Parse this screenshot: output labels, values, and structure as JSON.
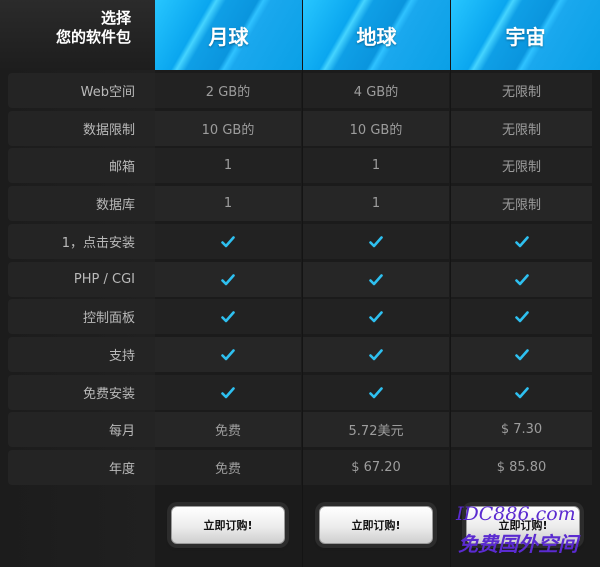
{
  "header": {
    "corner_title": "选择\n您的软件包",
    "plans": [
      "月球",
      "地球",
      "宇宙"
    ]
  },
  "rows": [
    {
      "label": "Web空间",
      "values": [
        "2 GB的",
        "4 GB的",
        "无限制"
      ]
    },
    {
      "label": "数据限制",
      "values": [
        "10 GB的",
        "10 GB的",
        "无限制"
      ]
    },
    {
      "label": "邮箱",
      "values": [
        "1",
        "1",
        "无限制"
      ]
    },
    {
      "label": "数据库",
      "values": [
        "1",
        "1",
        "无限制"
      ]
    },
    {
      "label": "1，点击安装",
      "values": [
        "check",
        "check",
        "check"
      ]
    },
    {
      "label": "PHP / CGI",
      "values": [
        "check",
        "check",
        "check"
      ]
    },
    {
      "label": "控制面板",
      "values": [
        "check",
        "check",
        "check"
      ]
    },
    {
      "label": "支持",
      "values": [
        "check",
        "check",
        "check"
      ]
    },
    {
      "label": "免费安装",
      "values": [
        "check",
        "check",
        "check"
      ]
    },
    {
      "label": "每月",
      "values": [
        "免费",
        "5.72美元",
        "$ 7.30"
      ]
    },
    {
      "label": "年度",
      "values": [
        "免费",
        "$ 67.20",
        "$ 85.80"
      ]
    }
  ],
  "buttons": {
    "order_label": "立即订购!"
  },
  "watermark": {
    "line1": "IDC886.com",
    "line2": "免费国外空间"
  },
  "colors": {
    "accent": "#0aa6ef",
    "check": "#2ec0f0"
  }
}
